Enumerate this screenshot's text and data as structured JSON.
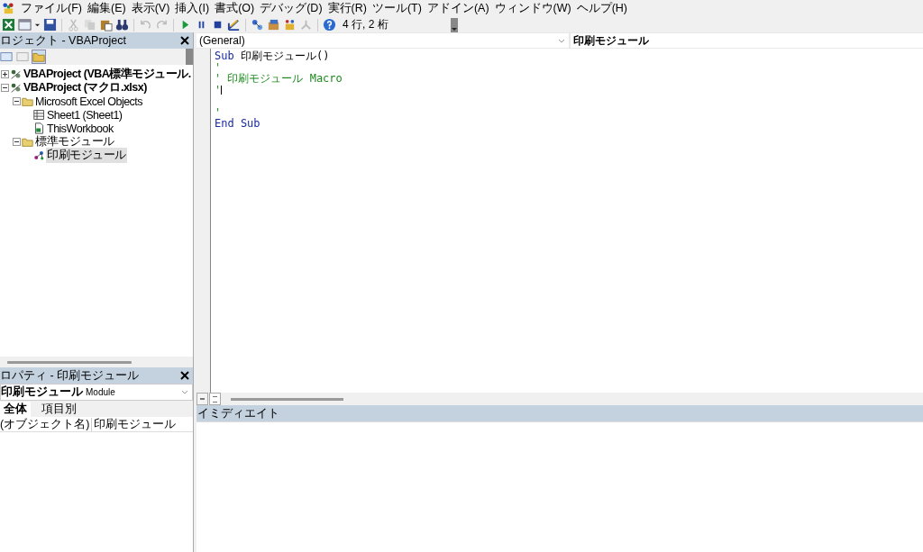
{
  "menu": [
    "ファイル(F)",
    "編集(E)",
    "表示(V)",
    "挿入(I)",
    "書式(O)",
    "デバッグ(D)",
    "実行(R)",
    "ツール(T)",
    "アドイン(A)",
    "ウィンドウ(W)",
    "ヘルプ(H)"
  ],
  "toolbar": {
    "position": "4 行, 2 桁"
  },
  "project_pane": {
    "title": "ロジェクト - VBAProject",
    "tree": [
      {
        "label": "VBAProject (VBA標準モジュール.",
        "kind": "project",
        "bold": true,
        "expanded": false,
        "selected": false
      },
      {
        "label": "VBAProject (マクロ.xlsx)",
        "kind": "project",
        "bold": true,
        "expanded": true,
        "selected": false,
        "children": [
          {
            "label": "Microsoft Excel Objects",
            "kind": "folder",
            "bold": false,
            "expanded": true,
            "selected": false,
            "children": [
              {
                "label": "Sheet1 (Sheet1)",
                "kind": "sheet",
                "bold": false,
                "selected": false
              },
              {
                "label": "ThisWorkbook",
                "kind": "workbook",
                "bold": false,
                "selected": false
              }
            ]
          },
          {
            "label": "標準モジュール",
            "kind": "folder",
            "bold": false,
            "expanded": true,
            "selected": false,
            "children": [
              {
                "label": "印刷モジュール",
                "kind": "module",
                "bold": false,
                "selected": true
              }
            ]
          }
        ]
      }
    ]
  },
  "properties_pane": {
    "title": "ロパティ - 印刷モジュール",
    "object_name": "印刷モジュール",
    "object_type": "Module",
    "tabs": [
      {
        "label": "全体",
        "selected": true
      },
      {
        "label": "項目別",
        "selected": false
      }
    ],
    "rows": [
      {
        "name": "(オブジェクト名)",
        "value": "印刷モジュール"
      }
    ]
  },
  "code_window": {
    "object_combo": "(General)",
    "procedure_combo": "印刷モジュール",
    "lines": [
      [
        {
          "kind": "keyword",
          "text": "Sub"
        },
        {
          "kind": "plain",
          "text": " 印刷モジュール()"
        }
      ],
      [
        {
          "kind": "comment",
          "text": "'"
        }
      ],
      [
        {
          "kind": "comment",
          "text": "' 印刷モジュール Macro"
        }
      ],
      [
        {
          "kind": "comment",
          "text": "'"
        },
        {
          "kind": "caret"
        }
      ],
      [
        {
          "kind": "blank"
        }
      ],
      [
        {
          "kind": "comment",
          "text": "'"
        }
      ],
      [
        {
          "kind": "keyword",
          "text": "End Sub"
        }
      ]
    ]
  },
  "immediate_pane": {
    "title": "イミディエイト"
  }
}
